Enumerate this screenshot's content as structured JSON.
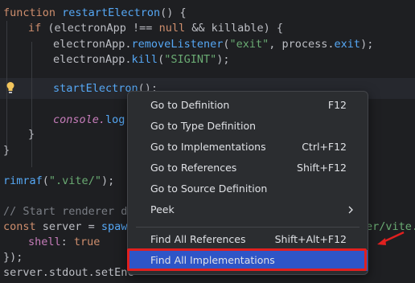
{
  "code": {
    "l1": {
      "kw": "function",
      "fn": "restartElectron",
      "rest": "() {"
    },
    "l2": {
      "kw": "if",
      "a": " (electronApp !== ",
      "kw2": "null",
      "b": " && killable) {"
    },
    "l3": {
      "a": "electronApp.",
      "fn": "removeListener",
      "b": "(",
      "str": "\"exit\"",
      "c": ", process.",
      "fn2": "exit",
      "d": ");"
    },
    "l4": {
      "a": "electronApp.",
      "fn": "kill",
      "b": "(",
      "str": "\"SIGINT\"",
      "c": ");"
    },
    "l5": {
      "fn": "startElectron",
      "b": "();"
    },
    "l6": {
      "a": "console.",
      "fn": "log",
      "b": "("
    },
    "l7": {
      "a": "}"
    },
    "l8": {
      "a": "}"
    },
    "l9": {
      "fn": "rimraf",
      "b": "(",
      "str": "\".vite/\"",
      "c": ");"
    },
    "l10": {
      "cm": "// Start renderer de"
    },
    "l11": {
      "kw": "const",
      "a": " server = ",
      "fn": "spawn",
      "str": "er/vite.",
      "tail": ""
    },
    "l12": {
      "prop": "shell",
      "a": ": ",
      "kw": "true"
    },
    "l13": {
      "a": "});"
    },
    "l14": {
      "a": "server.stdout.setEnc"
    }
  },
  "menu": {
    "items": [
      {
        "label": "Go to Definition",
        "shortcut": "F12"
      },
      {
        "label": "Go to Type Definition",
        "shortcut": ""
      },
      {
        "label": "Go to Implementations",
        "shortcut": "Ctrl+F12"
      },
      {
        "label": "Go to References",
        "shortcut": "Shift+F12"
      },
      {
        "label": "Go to Source Definition",
        "shortcut": ""
      },
      {
        "label": "Peek",
        "shortcut": ""
      },
      {
        "label": "Find All References",
        "shortcut": "Shift+Alt+F12"
      },
      {
        "label": "Find All Implementations",
        "shortcut": ""
      }
    ]
  },
  "colors": {
    "selection": "#2e55c7",
    "highlight_box": "#e0201f",
    "arrow": "#e0201f"
  },
  "icons": {
    "bulb": "lightbulb-icon",
    "submenu": "chevron-right-icon"
  }
}
